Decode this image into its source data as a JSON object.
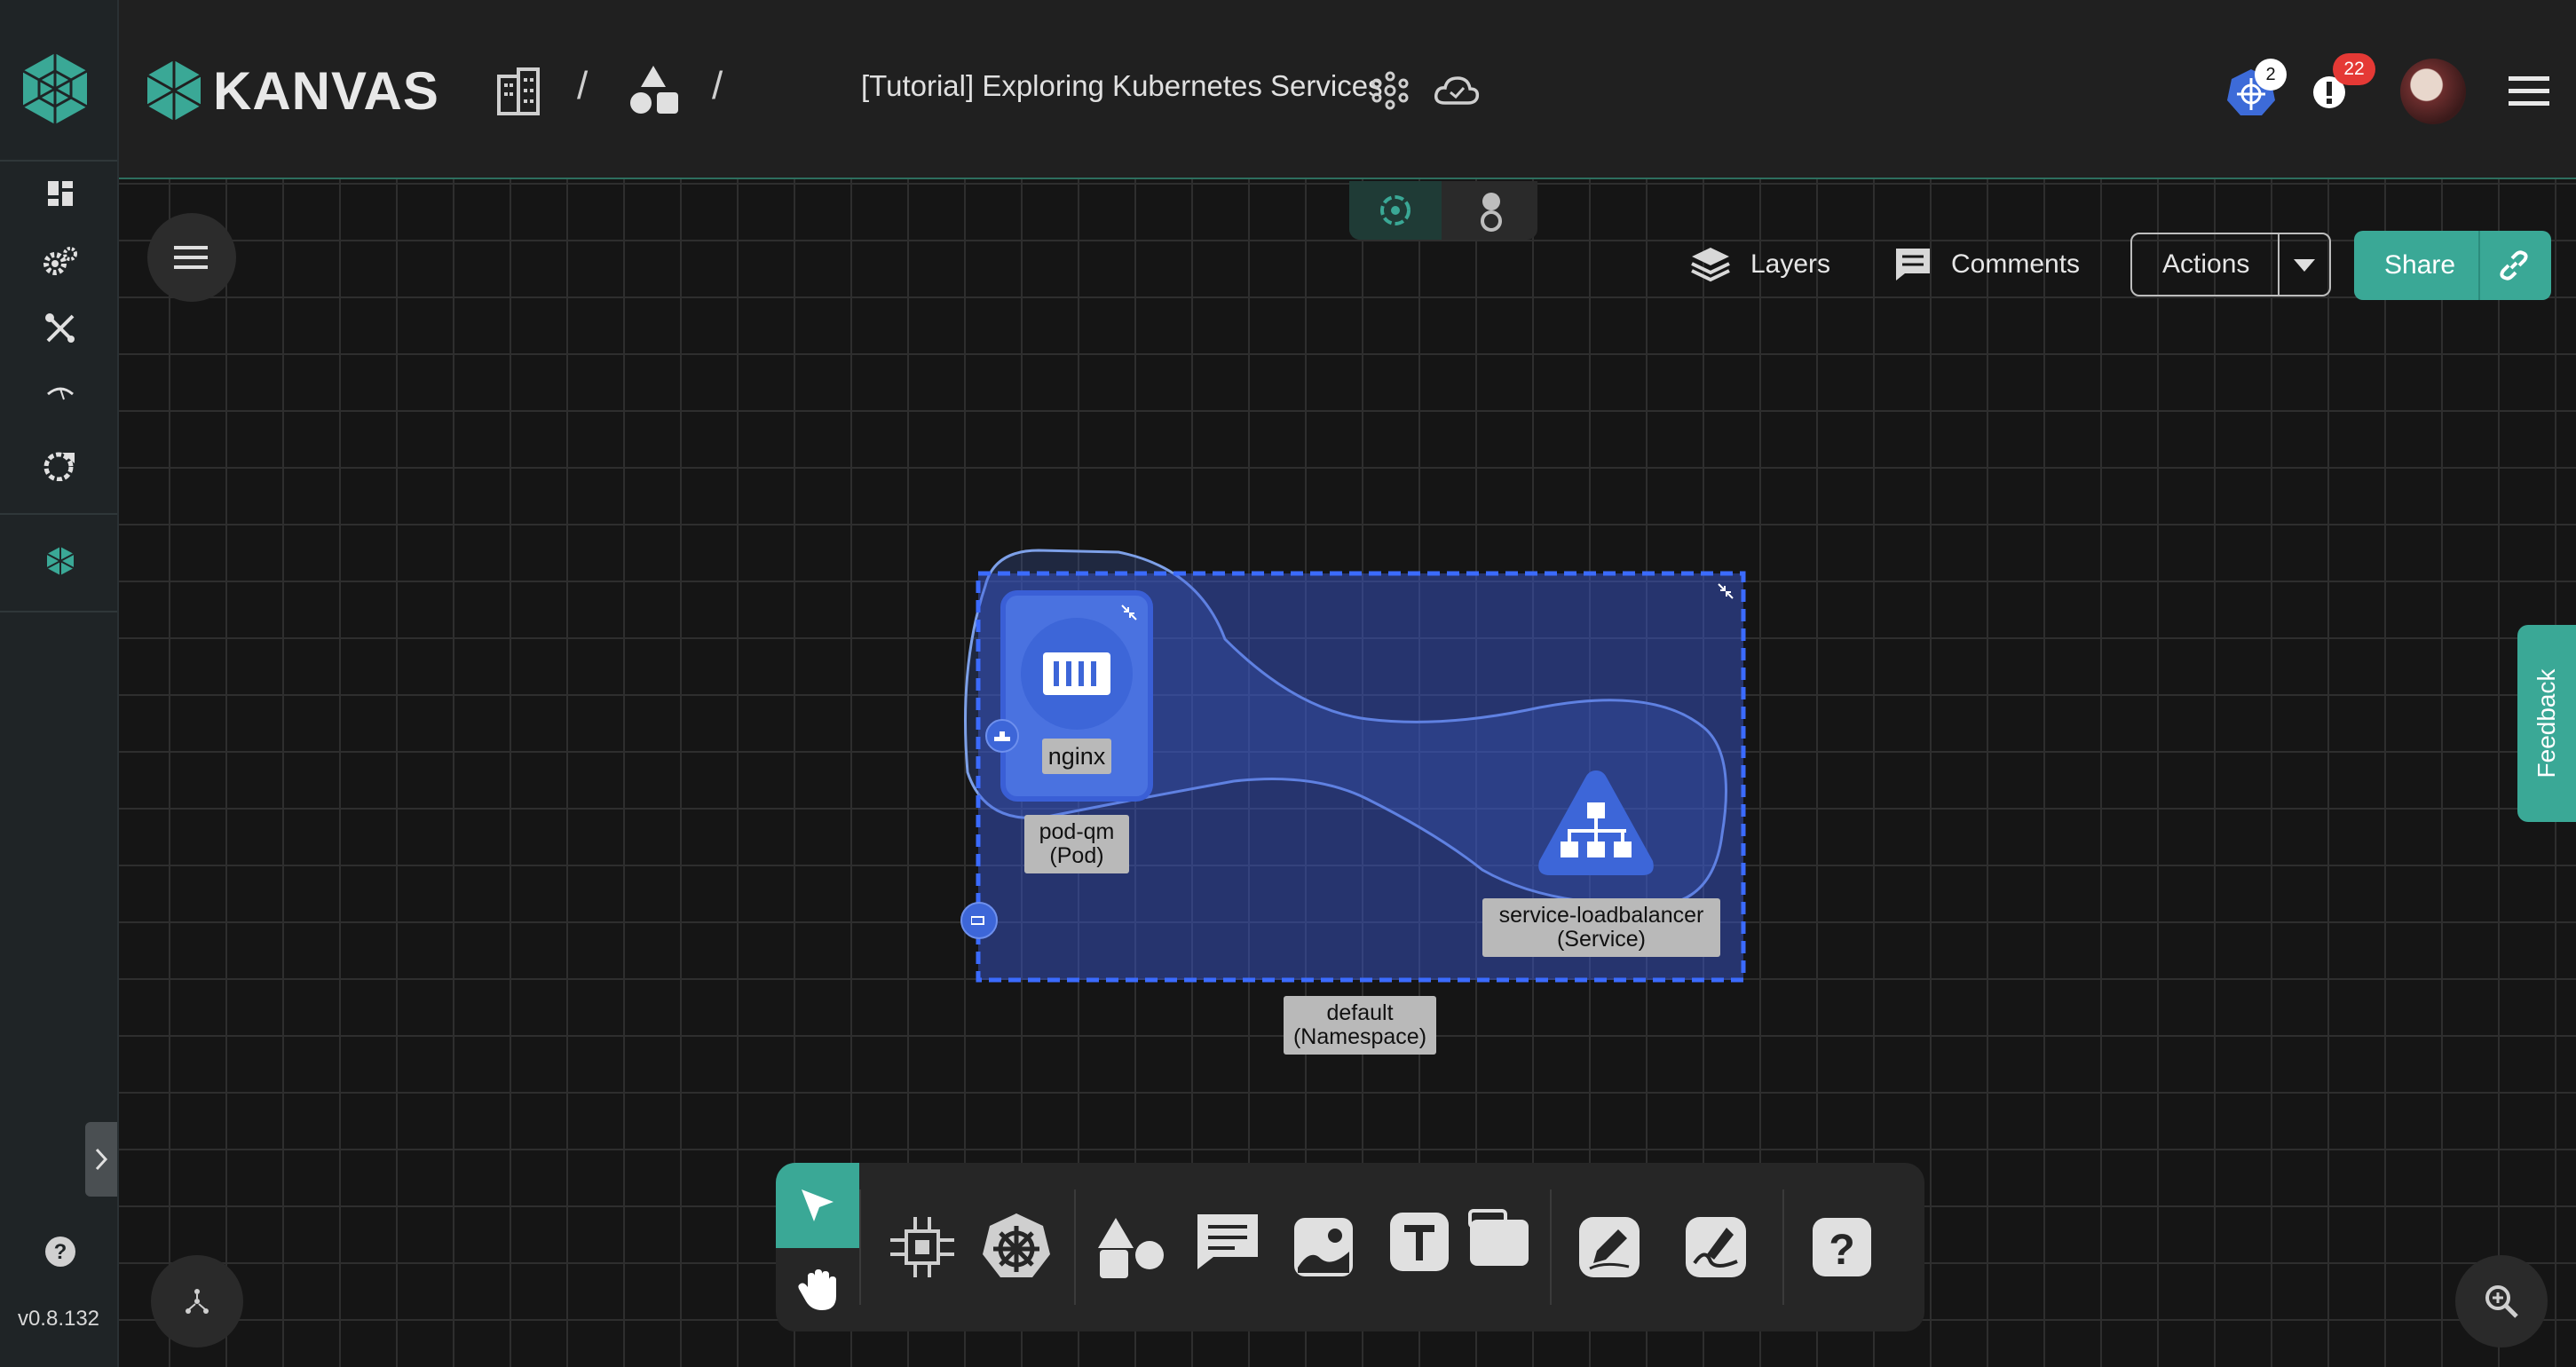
{
  "app": {
    "brand": "KANVAS",
    "version": "v0.8.132"
  },
  "header": {
    "breadcrumb_sep1": "/",
    "breadcrumb_sep2": "/",
    "design_title": "[Tutorial] Exploring Kubernetes Services"
  },
  "notifications": {
    "kubernetes_count": "2",
    "alerts_count": "22"
  },
  "canvas_toolbar": {
    "layers_label": "Layers",
    "comments_label": "Comments",
    "actions_label": "Actions",
    "share_label": "Share"
  },
  "feedback_label": "Feedback",
  "diagram": {
    "container_label": "nginx",
    "pod_label_line1": "pod-qm",
    "pod_label_line2": "(Pod)",
    "service_label_line1": "service-loadbalancer",
    "service_label_line2": "(Service)",
    "namespace_label_line1": "default",
    "namespace_label_line2": "(Namespace)"
  },
  "colors": {
    "accent": "#3aa896",
    "selection": "#3b5bdb",
    "badge_red": "#e53935"
  },
  "icons": [
    "kanvas-logo-icon",
    "dashboard-icon",
    "settings-icon",
    "tools-icon",
    "signal-icon",
    "analytics-icon",
    "meshery-icon",
    "help-icon",
    "building-icon",
    "shapes-icon",
    "network-icon",
    "cloud-icon",
    "kubernetes-icon",
    "alert-icon",
    "avatar",
    "hamburger-icon",
    "layers-icon",
    "comments-icon",
    "dropdown-icon",
    "link-icon",
    "pointer-icon",
    "hand-icon",
    "component-icon",
    "helm-icon",
    "shapes-tool-icon",
    "comment-tool-icon",
    "image-icon",
    "text-icon",
    "section-icon",
    "pen-icon",
    "signature-icon",
    "question-icon",
    "zoom-icon",
    "expand-arrow-icon"
  ]
}
